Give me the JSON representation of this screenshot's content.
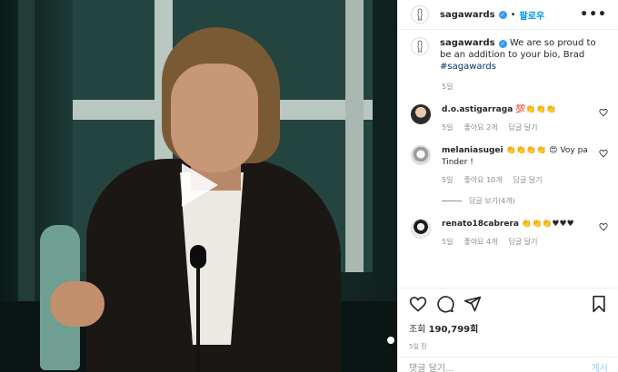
{
  "header": {
    "username": "sagawards",
    "separator": "•",
    "follow_label": "팔로우",
    "more": "•••"
  },
  "caption": {
    "username": "sagawards",
    "text": "We are so proud to be an addition to your bio, Brad ",
    "hashtag": "#sagawards",
    "time": "5일"
  },
  "comments": [
    {
      "username": "d.o.astigarraga",
      "text": "💯👏👏👏",
      "time": "5일",
      "likes": "좋아요 2개",
      "reply": "답글 달기"
    },
    {
      "username": "melaniasugei",
      "text": "👏👏👏👏 😍 Voy pa Tinder !",
      "time": "5일",
      "likes": "좋아요 10개",
      "reply": "답글 달기",
      "view_replies": "답글 보기(4개)"
    },
    {
      "username": "renato18cabrera",
      "text": "👏👏👏♥♥♥",
      "time": "5일",
      "likes": "좋아요 4개",
      "reply": "답글 달기"
    }
  ],
  "stats": {
    "views_label": "조회",
    "views_count": "190,799회",
    "time": "5일 전"
  },
  "add_comment": {
    "placeholder": "댓글 달기...",
    "post_label": "게시"
  },
  "icons": {
    "like": "heart-icon",
    "comment": "comment-icon",
    "share": "share-icon",
    "save": "bookmark-icon",
    "play": "play-icon"
  },
  "colors": {
    "accent": "#0095f6",
    "verified": "#3897f0",
    "muted": "#8e8e8e"
  }
}
